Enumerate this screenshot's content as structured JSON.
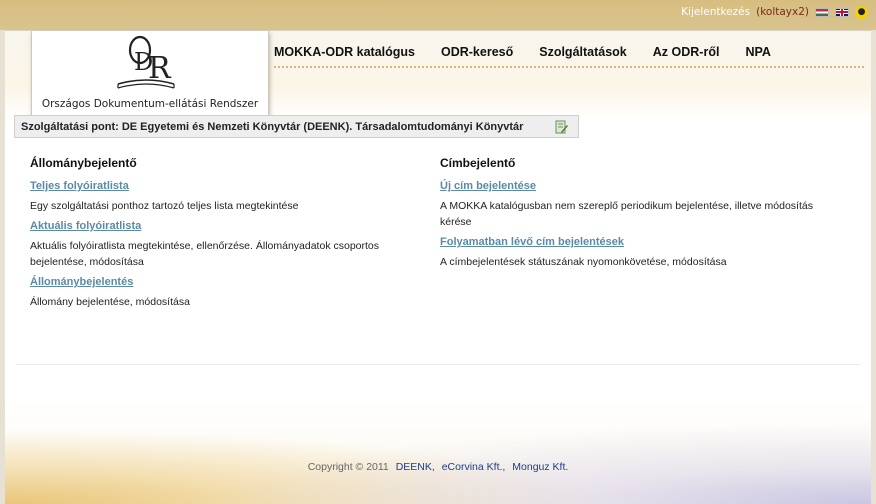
{
  "userbar": {
    "logout_label": "Kijelentkezés",
    "username": "(koltayx2)",
    "languages": [
      "hu-flag",
      "en-flag"
    ],
    "accessibility_icon": "accessibility-icon"
  },
  "logo": {
    "mark": "ODR",
    "caption": "Országos Dokumentum-ellátási Rendszer"
  },
  "nav": {
    "items": [
      {
        "label": "MOKKA-ODR katalógus"
      },
      {
        "label": "ODR-kereső"
      },
      {
        "label": "Szolgáltatások"
      },
      {
        "label": "Az ODR-ről"
      },
      {
        "label": "NPA"
      }
    ]
  },
  "service_point": {
    "text": "Szolgáltatási pont: DE Egyetemi és Nemzeti Könyvtár (DEENK). Társadalomtudományi Könyvtár",
    "edit_icon": "edit-icon"
  },
  "left_column": {
    "title": "Állománybejelentő",
    "items": [
      {
        "link": "Teljes folyóiratlista",
        "desc": "Egy szolgáltatási ponthoz tartozó teljes lista megtekintése"
      },
      {
        "link": "Aktuális folyóiratlista",
        "desc": "Aktuális folyóiratlista megtekintése, ellenőrzése. Állományadatok csoportos bejelentése, módosítása"
      },
      {
        "link": "Állománybejelentés",
        "desc": "Állomány bejelentése, módosítása"
      }
    ]
  },
  "right_column": {
    "title": "Címbejelentő",
    "items": [
      {
        "link": "Új cím bejelentése",
        "desc": "A MOKKA katalógusban nem szereplő periodikum bejelentése, illetve módosítás kérése"
      },
      {
        "link": "Folyamatban lévő cím bejelentések",
        "desc": "A címbejelentések státuszának nyomonkövetése, módosítása"
      }
    ]
  },
  "footer": {
    "copyright": "Copyright © 2011",
    "links": [
      "DEENK,",
      "eCorvina Kft.,",
      "Monguz Kft."
    ]
  },
  "colors": {
    "topbar": "#d7bd80",
    "link": "#5b8aa6",
    "username": "#7a2c1c",
    "footer_link": "#1c3f8a"
  }
}
